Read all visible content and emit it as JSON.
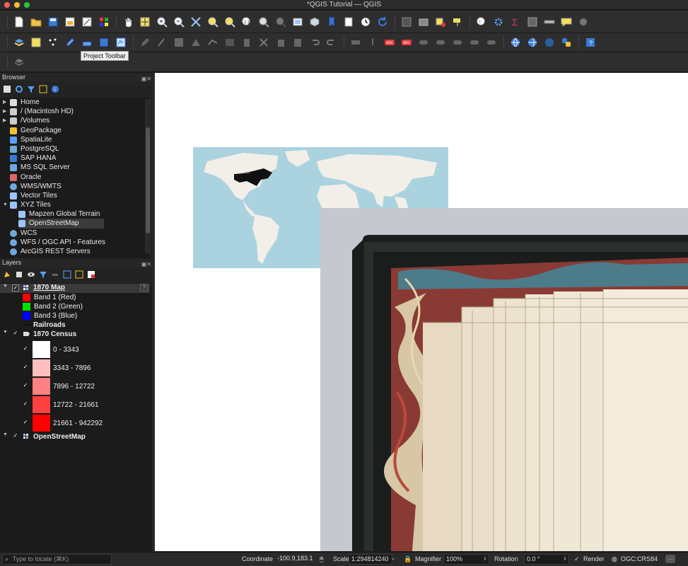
{
  "window": {
    "title": "*QGIS Tutorial — QGIS"
  },
  "tooltip": {
    "text": "Project Toolbar"
  },
  "browser": {
    "title": "Browser",
    "items": [
      {
        "label": "Home",
        "icon": "home-icon",
        "expandable": true
      },
      {
        "label": "/ (Macintosh HD)",
        "icon": "folder-icon",
        "expandable": true
      },
      {
        "label": "/Volumes",
        "icon": "folder-icon",
        "expandable": true
      },
      {
        "label": "GeoPackage",
        "icon": "geopackage-icon",
        "expandable": false
      },
      {
        "label": "SpatiaLite",
        "icon": "spatialite-icon",
        "expandable": false
      },
      {
        "label": "PostgreSQL",
        "icon": "postgresql-icon",
        "expandable": false
      },
      {
        "label": "SAP HANA",
        "icon": "saphana-icon",
        "expandable": false
      },
      {
        "label": "MS SQL Server",
        "icon": "mssql-icon",
        "expandable": false
      },
      {
        "label": "Oracle",
        "icon": "oracle-icon",
        "expandable": false
      },
      {
        "label": "WMS/WMTS",
        "icon": "globe-icon",
        "expandable": false
      },
      {
        "label": "Vector Tiles",
        "icon": "grid-icon",
        "expandable": false
      },
      {
        "label": "XYZ Tiles",
        "icon": "grid-icon",
        "expandable": true
      },
      {
        "label": "Mapzen Global Terrain",
        "icon": "grid-icon",
        "child": true
      },
      {
        "label": "OpenStreetMap",
        "icon": "grid-icon",
        "child": true,
        "selected": true
      },
      {
        "label": "WCS",
        "icon": "globe-icon",
        "expandable": false
      },
      {
        "label": "WFS / OGC API - Features",
        "icon": "globe-icon",
        "expandable": false
      },
      {
        "label": "ArcGIS REST Servers",
        "icon": "globe-icon",
        "expandable": false
      }
    ]
  },
  "layers": {
    "title": "Layers",
    "map_layer": {
      "name": "1870 Map",
      "bands": [
        {
          "label": "Band 1 (Red)",
          "color": "#ff0000"
        },
        {
          "label": "Band 2 (Green)",
          "color": "#00e000"
        },
        {
          "label": "Band 3 (Blue)",
          "color": "#0000ff"
        }
      ]
    },
    "railroads": {
      "name": "Railroads"
    },
    "census": {
      "name": "1870 Census",
      "classes": [
        {
          "label": "0 - 3343",
          "color": "#ffffff"
        },
        {
          "label": "3343 - 7896",
          "color": "#ffbfbf"
        },
        {
          "label": "7896 - 12722",
          "color": "#ff8080"
        },
        {
          "label": "12722 - 21661",
          "color": "#ff4040"
        },
        {
          "label": "21661 - 942292",
          "color": "#ff0000"
        }
      ]
    },
    "osm": {
      "name": "OpenStreetMap"
    }
  },
  "status": {
    "locate_placeholder": "Type to locate (⌘K)",
    "coordinate_label": "Coordinate",
    "coordinate_value": "-100.9,183.1",
    "scale_label": "Scale",
    "scale_value": "1:294814240",
    "magnifier_label": "Magnifier",
    "magnifier_value": "100%",
    "rotation_label": "Rotation",
    "rotation_value": "0.0 °",
    "render_label": "Render",
    "crs_label": "OGC:CRS84"
  }
}
